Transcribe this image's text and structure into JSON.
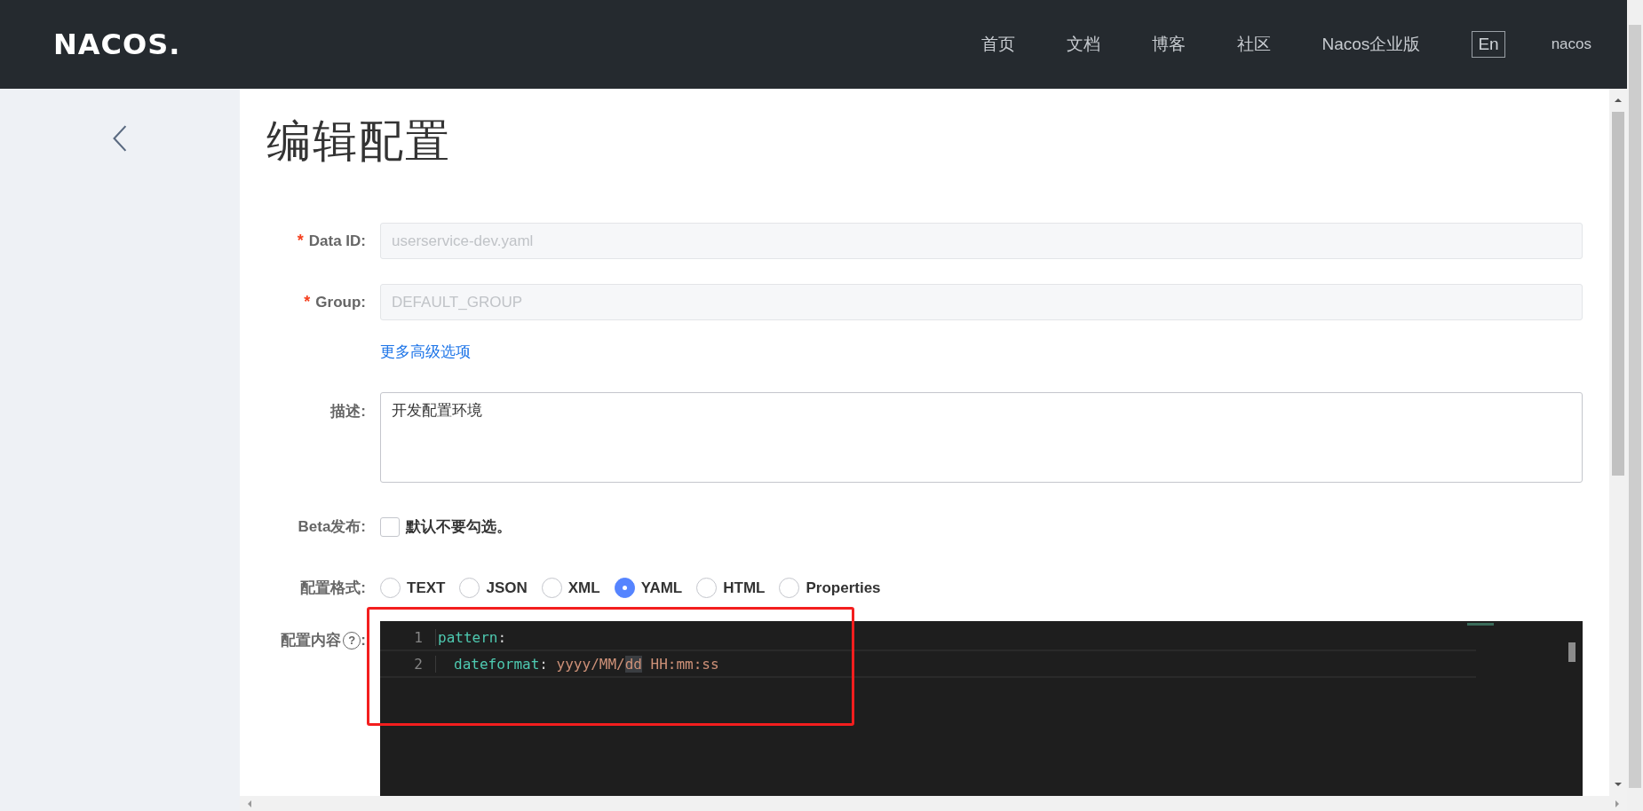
{
  "header": {
    "logo": "NACOS.",
    "nav": [
      "首页",
      "文档",
      "博客",
      "社区",
      "Nacos企业版"
    ],
    "language": "En",
    "user": "nacos"
  },
  "title": "编辑配置",
  "fields": [
    {
      "label": "Data ID:",
      "required_mark": "*",
      "value": "userservice-dev.yaml",
      "disabled": true
    },
    {
      "label": "Group:",
      "required_mark": "*",
      "value": "DEFAULT_GROUP",
      "disabled": true
    }
  ],
  "advanced_link": "更多高级选项",
  "description": {
    "label": "描述:",
    "value": "开发配置环境"
  },
  "beta": {
    "label": "Beta发布:",
    "checked": false,
    "text": "默认不要勾选。"
  },
  "format": {
    "label": "配置格式:",
    "options": [
      {
        "label": "TEXT",
        "selected": false
      },
      {
        "label": "JSON",
        "selected": false
      },
      {
        "label": "XML",
        "selected": false
      },
      {
        "label": "YAML",
        "selected": true
      },
      {
        "label": "HTML",
        "selected": false
      },
      {
        "label": "Properties",
        "selected": false
      }
    ]
  },
  "content": {
    "label": "配置内容",
    "help": "?",
    "label_suffix": ":",
    "lines": [
      {
        "number": "1",
        "indented": false,
        "tokens": [
          {
            "kind": "key",
            "text": "pattern"
          },
          {
            "kind": "punct",
            "text": ":"
          }
        ]
      },
      {
        "number": "2",
        "indented": true,
        "tokens": [
          {
            "kind": "key",
            "text": "dateformat"
          },
          {
            "kind": "punct",
            "text": ": "
          },
          {
            "kind": "value",
            "text": "yyyy/MM/"
          },
          {
            "kind": "highlight",
            "text": "dd"
          },
          {
            "kind": "value",
            "text": " HH:mm:ss"
          }
        ]
      }
    ]
  }
}
